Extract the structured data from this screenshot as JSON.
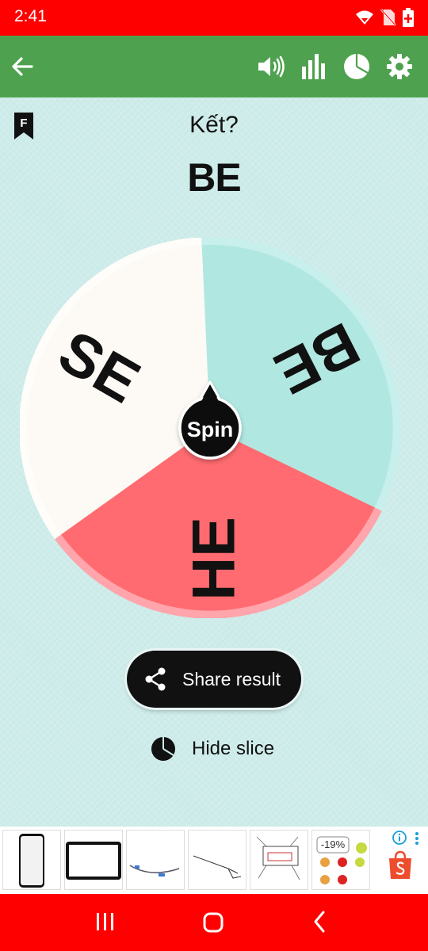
{
  "status_bar": {
    "time": "2:41"
  },
  "app_bar": {
    "back_icon": "arrow-left-icon",
    "icons": [
      "volume-icon",
      "stats-icon",
      "pie-chart-icon",
      "settings-icon"
    ]
  },
  "header": {
    "bookmark_letter": "F",
    "question": "Kết?",
    "result": "BE"
  },
  "wheel": {
    "slices": [
      {
        "label": "BE",
        "color": "#b1e7e1"
      },
      {
        "label": "HE",
        "color": "#ff6b70"
      },
      {
        "label": "SE",
        "color": "#fdfaf5"
      }
    ],
    "spin_label": "Spin"
  },
  "actions": {
    "share_label": "Share result",
    "hide_label": "Hide slice"
  },
  "ad": {
    "discount": "-19%"
  },
  "colors": {
    "status_bar": "#ff0000",
    "app_bar": "#4ea24f",
    "background": "#cdecea",
    "nav_bar": "#ff0000"
  }
}
